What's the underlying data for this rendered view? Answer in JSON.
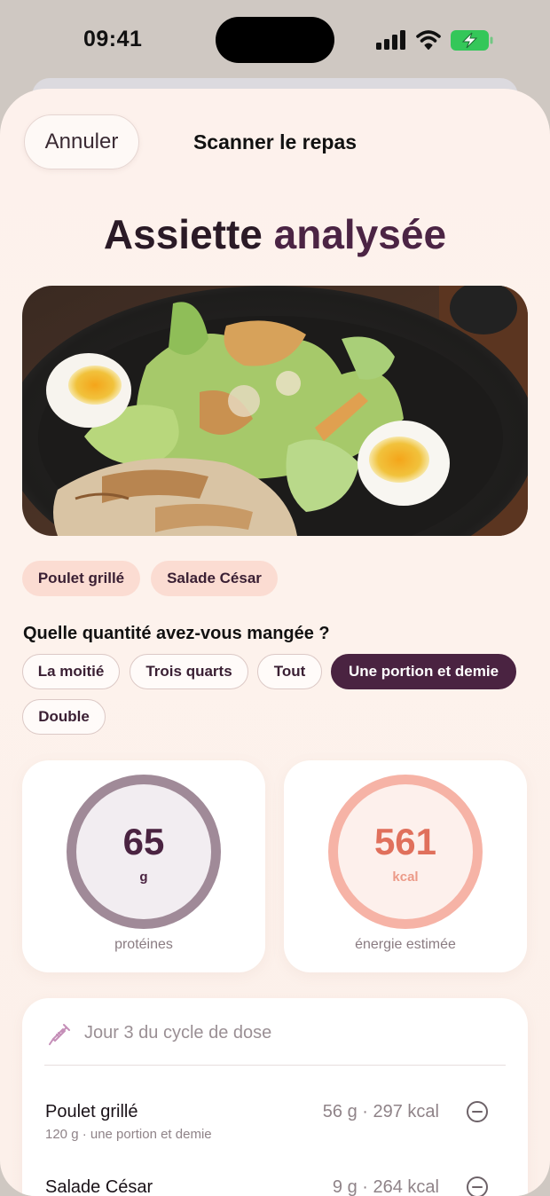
{
  "status": {
    "time": "09:41"
  },
  "nav": {
    "cancel_label": "Annuler",
    "title": "Scanner le repas"
  },
  "page": {
    "title_main": "Assiette",
    "title_accent": "analysée"
  },
  "tags": [
    "Poulet grillé",
    "Salade César"
  ],
  "question": "Quelle quantité avez-vous mangée ?",
  "portions": {
    "options": [
      "La moitié",
      "Trois quarts",
      "Tout",
      "Une portion et demie",
      "Double"
    ],
    "selected": "Une portion et demie"
  },
  "stats": {
    "protein": {
      "value": "65",
      "unit": "g",
      "label": "protéines"
    },
    "energy": {
      "value": "561",
      "unit": "kcal",
      "label": "énergie estimée"
    }
  },
  "dose": {
    "cycle_text": "Jour 3 du cycle de dose"
  },
  "foods": [
    {
      "name": "Poulet grillé",
      "detail": "120 g · une portion et demie",
      "stats": "56 g · 297 kcal"
    },
    {
      "name": "Salade César",
      "detail": "",
      "stats": "9 g · 264 kcal"
    }
  ],
  "colors": {
    "accent": "#4a2341",
    "protein_ring": "#a08a98",
    "energy_ring": "#f6b3a6",
    "energy_text": "#e0705c",
    "battery": "#34c759"
  }
}
